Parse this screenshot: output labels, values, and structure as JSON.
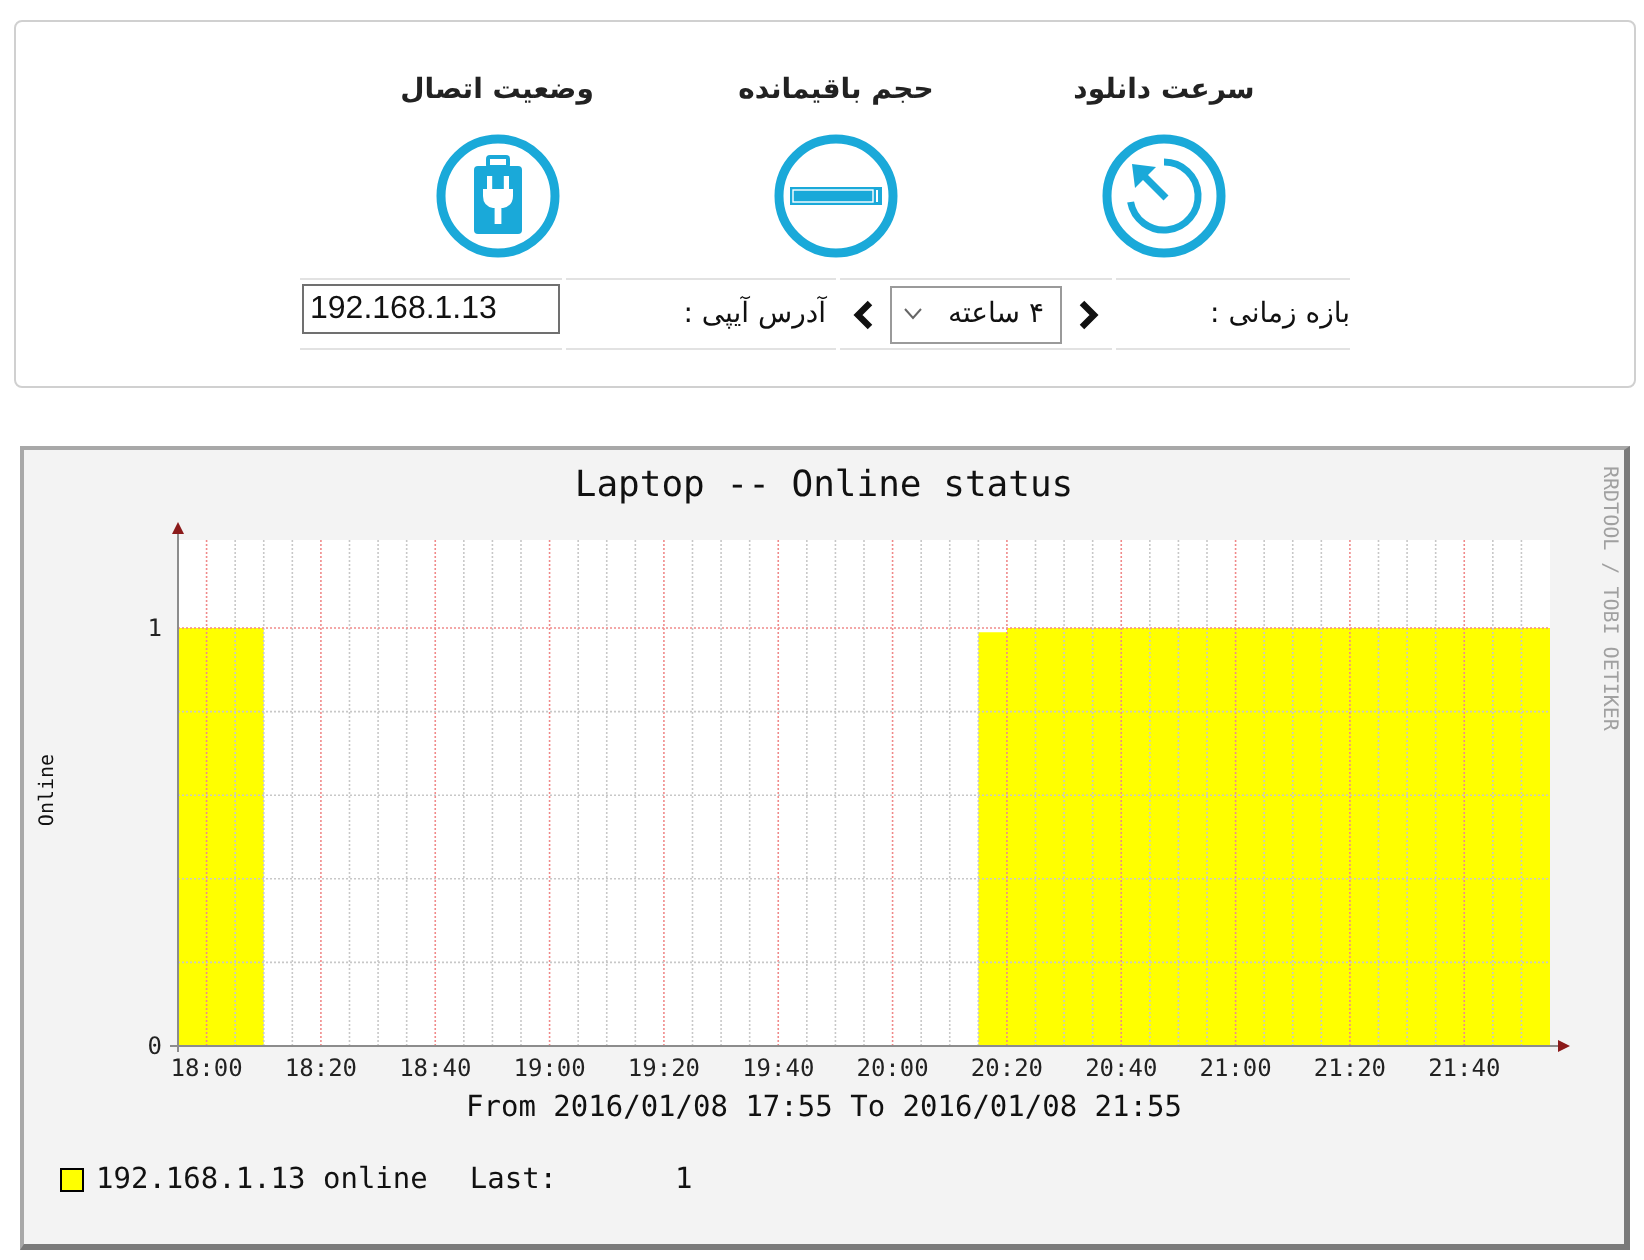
{
  "stats": [
    {
      "kind": "download_speed",
      "label": "سرعت دانلود"
    },
    {
      "kind": "remaining_volume",
      "label": "حجم باقیمانده"
    },
    {
      "kind": "connection_status",
      "label": "وضعیت اتصال"
    }
  ],
  "filters": {
    "range_label": "بازه زمانی :",
    "range_select": {
      "value": "۴ ساعته"
    },
    "ip_label": "آدرس آیپی :",
    "ip_field": {
      "value": "192.168.1.13"
    }
  },
  "graph": {
    "credit": "RRDTOOL / TOBI OETIKER",
    "chart_data": {
      "type": "area",
      "title": "Laptop -- Online status",
      "xlabel": "From 2016/01/08 17:55 To 2016/01/08 21:55",
      "ylabel": "Online",
      "categories": [
        null,
        "18:00",
        null,
        null,
        null,
        "18:20",
        null,
        null,
        null,
        "18:40",
        null,
        null,
        null,
        "19:00",
        null,
        null,
        null,
        "19:20",
        null,
        null,
        null,
        "19:40",
        null,
        null,
        null,
        "20:00",
        null,
        null,
        null,
        "20:20",
        null,
        null,
        null,
        "20:40",
        null,
        null,
        null,
        "21:00",
        null,
        null,
        null,
        "21:20",
        null,
        null,
        null,
        "21:40",
        null,
        null,
        null
      ],
      "series": [
        {
          "name": "192.168.1.13 online",
          "color": "#ffff00",
          "values": [
            1,
            1,
            1,
            0,
            0,
            0,
            0,
            0,
            0,
            0,
            0,
            0,
            0,
            0,
            0,
            0,
            0,
            0,
            0,
            0,
            0,
            0,
            0,
            0,
            0,
            0,
            0,
            0,
            0.99,
            1,
            1,
            1,
            1,
            1,
            1,
            1,
            1,
            1,
            1,
            1,
            1,
            1,
            1,
            1,
            1,
            1,
            1,
            1,
            1
          ]
        }
      ],
      "ylim": [
        0,
        1.2
      ],
      "yticks": [
        0,
        1
      ],
      "grid": true
    },
    "legend": {
      "last_label": "Last:",
      "last_value": "1"
    }
  }
}
